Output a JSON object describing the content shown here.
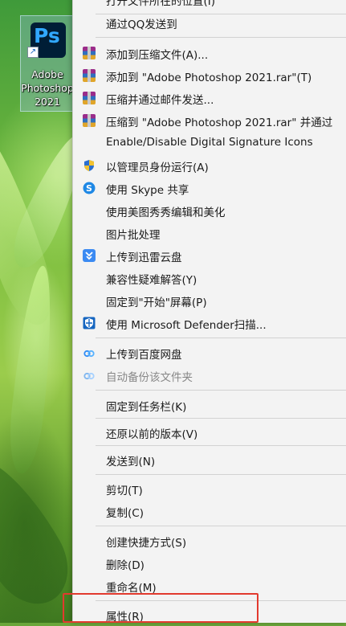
{
  "desktop": {
    "icon_label_line1": "Adobe",
    "icon_label_line2": "Photoshop",
    "icon_label_line3": "2021",
    "app_glyph": "Ps"
  },
  "menu": {
    "top_partial": "打开文件所在的位置(I)",
    "items": [
      {
        "label": "通过QQ发送到",
        "icon": null
      },
      {
        "label": "添加到压缩文件(A)...",
        "icon": "winrar-icon"
      },
      {
        "label": "添加到 \"Adobe Photoshop 2021.rar\"(T)",
        "icon": "winrar-icon"
      },
      {
        "label": "压缩并通过邮件发送...",
        "icon": "winrar-icon"
      },
      {
        "label": "压缩到 \"Adobe Photoshop 2021.rar\" 并通过",
        "icon": "winrar-icon"
      },
      {
        "label": "Enable/Disable Digital Signature Icons",
        "icon": null
      },
      {
        "label": "以管理员身份运行(A)",
        "icon": "uac-shield-icon"
      },
      {
        "label": "使用 Skype 共享",
        "icon": "skype-icon"
      },
      {
        "label": "使用美图秀秀编辑和美化",
        "icon": null
      },
      {
        "label": "图片批处理",
        "icon": null
      },
      {
        "label": "上传到迅雷云盘",
        "icon": "xunlei-icon"
      },
      {
        "label": "兼容性疑难解答(Y)",
        "icon": null
      },
      {
        "label": "固定到\"开始\"屏幕(P)",
        "icon": null
      },
      {
        "label": "使用 Microsoft Defender扫描...",
        "icon": "defender-icon"
      },
      {
        "label": "上传到百度网盘",
        "icon": "baidu-netdisk-icon"
      },
      {
        "label": "自动备份该文件夹",
        "icon": "baidu-netdisk-icon",
        "disabled": true
      },
      {
        "label": "固定到任务栏(K)",
        "icon": null
      },
      {
        "label": "还原以前的版本(V)",
        "icon": null
      },
      {
        "label": "发送到(N)",
        "icon": null
      },
      {
        "label": "剪切(T)",
        "icon": null
      },
      {
        "label": "复制(C)",
        "icon": null
      },
      {
        "label": "创建快捷方式(S)",
        "icon": null
      },
      {
        "label": "删除(D)",
        "icon": null
      },
      {
        "label": "重命名(M)",
        "icon": null
      },
      {
        "label": "属性(R)",
        "icon": null
      }
    ]
  },
  "colors": {
    "menu_bg": "#f3f3f3",
    "highlight_border": "#e23a2e",
    "ps_bg": "#001e36",
    "ps_fg": "#31a8ff"
  }
}
